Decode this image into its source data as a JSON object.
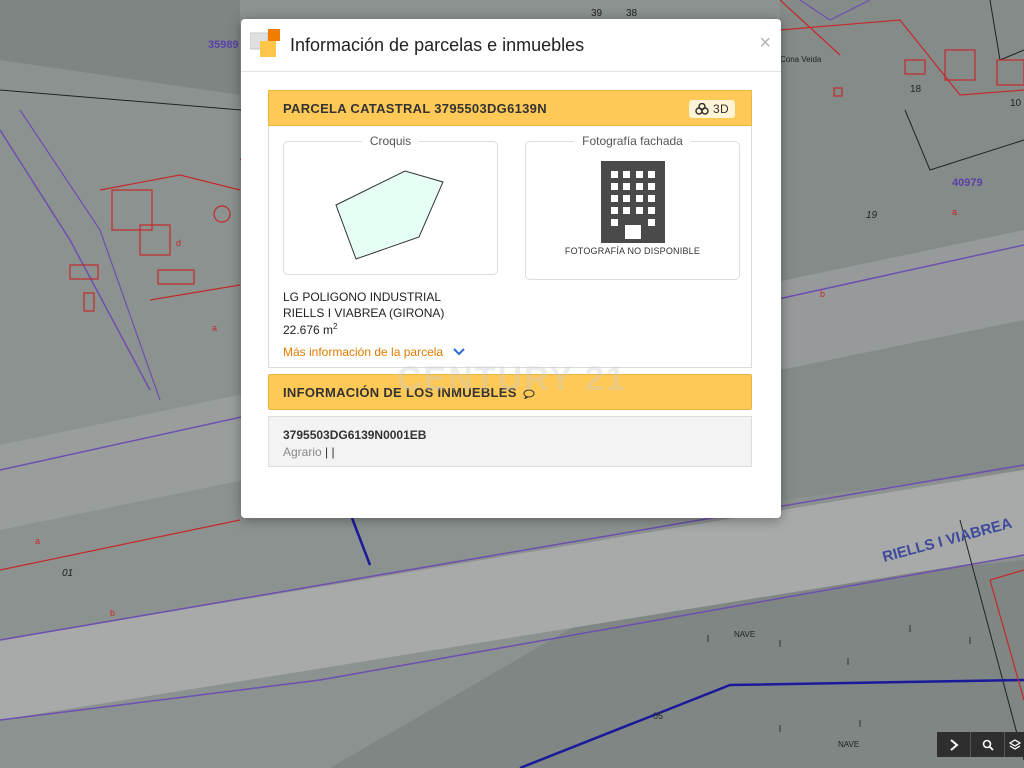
{
  "map": {
    "labels": {
      "parcel_35989": "35989",
      "parcel_39": "39",
      "parcel_38": "38",
      "cona_veida": "Cona Veida",
      "parcel_18": "18",
      "parcel_10": "10",
      "parcel_40979": "40979",
      "parcel_19": "19",
      "sub_a_right": "a",
      "sub_b_right": "b",
      "sub_a_left": "a",
      "sub_d": "d",
      "sub_a_lower": "a",
      "parcel_01": "01",
      "sub_b_lower": "b",
      "street": "RIELLS I VIABREA",
      "nave_1": "NAVE",
      "nave_2": "NAVE",
      "parcel_05": "05"
    },
    "colors": {
      "background": "#8c9290",
      "parcel_line": "#c42a2a",
      "boundary": "#6e4fb0",
      "road": "#a7aaa9"
    }
  },
  "modal": {
    "title": "Información de parcelas e inmuebles",
    "close_symbol": "×",
    "parcel": {
      "header": "PARCELA CATASTRAL 3795503DG6139N",
      "btn_3d_label": "3D",
      "sketch_label": "Croquis",
      "photo_label": "Fotografía fachada",
      "photo_unavailable": "FOTOGRAFÍA NO DISPONIBLE",
      "address_line1": "LG POLIGONO INDUSTRIAL",
      "address_line2": "RIELLS I VIABREA (GIRONA)",
      "area_value": "22.676 m",
      "area_unit_sup": "2",
      "more_info_link": "Más información de la parcela"
    },
    "properties": {
      "header": "INFORMACIÓN DE LOS INMUEBLES",
      "watermark": "CENTURY 21",
      "items": [
        {
          "reference": "3795503DG6139N0001EB",
          "use": "Agrario",
          "separators": "| |"
        }
      ]
    },
    "colors": {
      "header_bg": "#fec957",
      "link": "#e07b00",
      "chevron": "#2a6ad8"
    }
  },
  "toolbar": {
    "icons": [
      "chevron-right-icon",
      "search-icon",
      "layers-icon"
    ]
  }
}
